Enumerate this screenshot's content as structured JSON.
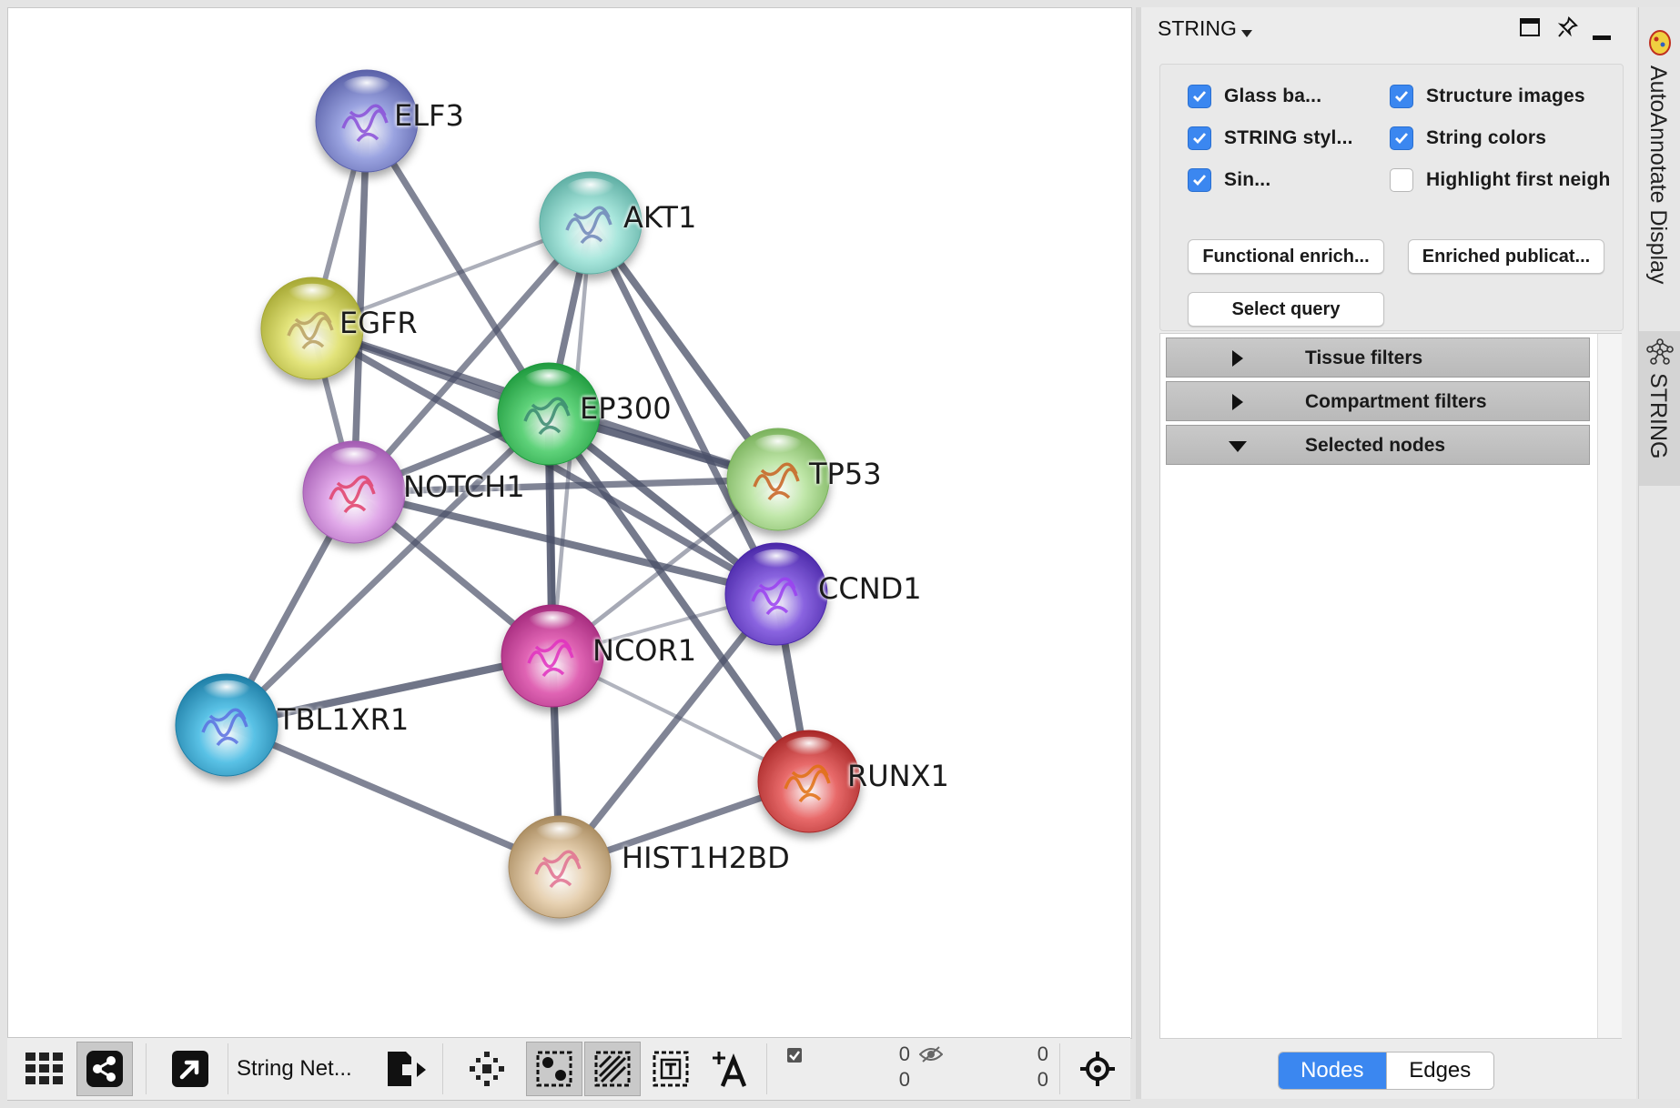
{
  "network": {
    "nodes": [
      {
        "id": "ELF3",
        "label": "ELF3",
        "color": "#9aa3e0",
        "dark": "#5a61a8",
        "structure": "#8a4fd8"
      },
      {
        "id": "AKT1",
        "label": "AKT1",
        "color": "#a8e6dc",
        "dark": "#5eaea3",
        "structure": "#6e86b8"
      },
      {
        "id": "EGFR",
        "label": "EGFR",
        "color": "#e2e37a",
        "dark": "#a6a834",
        "structure": "#b8a060"
      },
      {
        "id": "EP300",
        "label": "EP300",
        "color": "#5fd27a",
        "dark": "#1f9a3e",
        "structure": "#3a8a70"
      },
      {
        "id": "NOTCH1",
        "label": "NOTCH1",
        "color": "#e0a8e8",
        "dark": "#a35bb2",
        "structure": "#e0406a"
      },
      {
        "id": "TP53",
        "label": "TP53",
        "color": "#bfe6a8",
        "dark": "#7ab25c",
        "structure": "#c86020"
      },
      {
        "id": "CCND1",
        "label": "CCND1",
        "color": "#8a64e0",
        "dark": "#4a28a8",
        "structure": "#9a40f0"
      },
      {
        "id": "NCOR1",
        "label": "NCOR1",
        "color": "#e064b4",
        "dark": "#a42a7c",
        "structure": "#e030c0"
      },
      {
        "id": "TBL1XR1",
        "label": "TBL1XR1",
        "color": "#5ac2e6",
        "dark": "#1f7ea6",
        "structure": "#5a70e0"
      },
      {
        "id": "RUNX1",
        "label": "RUNX1",
        "color": "#e86a6a",
        "dark": "#a82828",
        "structure": "#e07010"
      },
      {
        "id": "HIST1H2BD",
        "label": "HIST1H2BD",
        "color": "#e6d0b0",
        "dark": "#a88a5e",
        "structure": "#e07090"
      }
    ],
    "edges": [
      {
        "source": "ELF3",
        "target": "EGFR",
        "weight": 0.55
      },
      {
        "source": "ELF3",
        "target": "NOTCH1",
        "weight": 0.8
      },
      {
        "source": "ELF3",
        "target": "EP300",
        "weight": 0.75
      },
      {
        "source": "AKT1",
        "target": "EGFR",
        "weight": 0.35
      },
      {
        "source": "AKT1",
        "target": "EP300",
        "weight": 0.8
      },
      {
        "source": "AKT1",
        "target": "NOTCH1",
        "weight": 0.7
      },
      {
        "source": "AKT1",
        "target": "TP53",
        "weight": 0.85
      },
      {
        "source": "AKT1",
        "target": "CCND1",
        "weight": 0.8
      },
      {
        "source": "AKT1",
        "target": "NCOR1",
        "weight": 0.35
      },
      {
        "source": "EGFR",
        "target": "NOTCH1",
        "weight": 0.6
      },
      {
        "source": "EGFR",
        "target": "EP300",
        "weight": 0.8
      },
      {
        "source": "EGFR",
        "target": "TP53",
        "weight": 0.8
      },
      {
        "source": "EGFR",
        "target": "CCND1",
        "weight": 0.8
      },
      {
        "source": "EP300",
        "target": "NOTCH1",
        "weight": 0.75
      },
      {
        "source": "EP300",
        "target": "TP53",
        "weight": 1.0
      },
      {
        "source": "EP300",
        "target": "CCND1",
        "weight": 0.9
      },
      {
        "source": "EP300",
        "target": "NCOR1",
        "weight": 1.0
      },
      {
        "source": "EP300",
        "target": "RUNX1",
        "weight": 0.85
      },
      {
        "source": "EP300",
        "target": "TBL1XR1",
        "weight": 0.7
      },
      {
        "source": "EP300",
        "target": "HIST1H2BD",
        "weight": 0.35
      },
      {
        "source": "NOTCH1",
        "target": "TP53",
        "weight": 0.75
      },
      {
        "source": "NOTCH1",
        "target": "CCND1",
        "weight": 0.85
      },
      {
        "source": "NOTCH1",
        "target": "NCOR1",
        "weight": 0.75
      },
      {
        "source": "NOTCH1",
        "target": "TBL1XR1",
        "weight": 0.75
      },
      {
        "source": "TP53",
        "target": "NCOR1",
        "weight": 0.4
      },
      {
        "source": "CCND1",
        "target": "NCOR1",
        "weight": 0.25
      },
      {
        "source": "CCND1",
        "target": "RUNX1",
        "weight": 0.85
      },
      {
        "source": "CCND1",
        "target": "HIST1H2BD",
        "weight": 0.75
      },
      {
        "source": "NCOR1",
        "target": "TBL1XR1",
        "weight": 0.9
      },
      {
        "source": "NCOR1",
        "target": "HIST1H2BD",
        "weight": 0.9
      },
      {
        "source": "NCOR1",
        "target": "RUNX1",
        "weight": 0.3
      },
      {
        "source": "TBL1XR1",
        "target": "HIST1H2BD",
        "weight": 0.75
      },
      {
        "source": "RUNX1",
        "target": "HIST1H2BD",
        "weight": 0.75
      }
    ]
  },
  "toolbar": {
    "network_name": "String Net...",
    "counts": {
      "selected_top": "0",
      "selected_bottom": "0",
      "hidden_top": "0",
      "hidden_bottom": "0"
    }
  },
  "panel": {
    "title": "STRING",
    "options": {
      "glass_balls": {
        "label": "Glass ba...",
        "checked": true
      },
      "structure_images": {
        "label": "Structure images",
        "checked": true
      },
      "string_style": {
        "label": "STRING styl...",
        "checked": true
      },
      "string_colors": {
        "label": "String colors",
        "checked": true
      },
      "single": {
        "label": "Sin...",
        "checked": true
      },
      "highlight_first_neighbors": {
        "label": "Highlight first neigh",
        "checked": false
      }
    },
    "buttons": {
      "functional_enrichment": "Functional enrich...",
      "enriched_publications": "Enriched publicat...",
      "select_query": "Select query"
    },
    "sections": [
      {
        "label": "Tissue filters",
        "expanded": false
      },
      {
        "label": "Compartment filters",
        "expanded": false
      },
      {
        "label": "Selected nodes",
        "expanded": true
      }
    ],
    "tabs": {
      "nodes": "Nodes",
      "edges": "Edges",
      "active": "Nodes"
    }
  },
  "side_tabs": {
    "autoannotate": "AutoAnnotate Display",
    "string": "STRING"
  },
  "colors": {
    "accent": "#3b87f0",
    "edge": "#4a5068"
  }
}
